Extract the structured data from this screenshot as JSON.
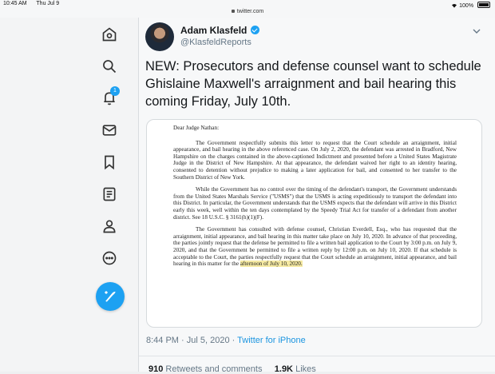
{
  "statusbar": {
    "time": "10:45 AM",
    "date": "Thu Jul 9",
    "url": "twitter.com",
    "battery": "100%"
  },
  "sidebar": {
    "items": [
      {
        "icon": "home-icon"
      },
      {
        "icon": "explore-icon"
      },
      {
        "icon": "notifications-icon",
        "badge": "1"
      },
      {
        "icon": "messages-icon"
      },
      {
        "icon": "bookmarks-icon"
      },
      {
        "icon": "lists-icon"
      },
      {
        "icon": "profile-icon"
      },
      {
        "icon": "more-icon"
      }
    ],
    "compose_icon": "compose-tweet-icon"
  },
  "tweet": {
    "author_name": "Adam Klasfeld",
    "author_handle": "@KlasfeldReports",
    "text": "NEW: Prosecutors and defense counsel want to schedule Ghislaine Maxwell's arraignment and bail hearing this coming Friday, July 10th.",
    "timestamp": "8:44 PM · Jul 5, 2020 · ",
    "source": "Twitter for iPhone",
    "retweets_count": "910",
    "retweets_label": "Retweets and comments",
    "likes_count": "1.9K",
    "likes_label": "Likes"
  },
  "document": {
    "salutation": "Dear Judge Nathan:",
    "p1": "The Government respectfully submits this letter to request that the Court schedule an arraignment, initial appearance, and bail hearing in the above referenced case. On July 2, 2020, the defendant was arrested in Bradford, New Hampshire on the charges contained in the above-captioned Indictment and presented before a United States Magistrate Judge in the District of New Hampshire. At that appearance, the defendant waived her right to an identity hearing, consented to detention without prejudice to making a later application for bail, and consented to her transfer to the Southern District of New York.",
    "p2": "While the Government has no control over the timing of the defendant's transport, the Government understands from the United States Marshals Service (\"USMS\") that the USMS is acting expeditiously to transport the defendant into this District. In particular, the Government understands that the USMS expects that the defendant will arrive in this District early this week, well within the ten days contemplated by the Speedy Trial Act for transfer of a defendant from another district. See 18 U.S.C. § 3161(h)(1)(F).",
    "p3": "The Government has consulted with defense counsel, Christian Everdell, Esq., who has requested that the arraignment, initial appearance, and bail hearing in this matter take place on July 10, 2020. In advance of that proceeding, the parties jointly request that the defense be permitted to file a written bail application to the Court by 3:00 p.m. on July 9, 2020, and that the Government be permitted to file a written reply by 12:00 p.m. on July 10, 2020. If that schedule is acceptable to the Court, the parties respectfully request that the Court schedule an arraignment, initial appearance, and bail hearing in this matter for the ",
    "p3_highlight": "afternoon of July 10, 2020."
  },
  "colors": {
    "accent": "#1da1f2",
    "highlight": "#f6eaa3",
    "secondary_text": "#657786"
  }
}
